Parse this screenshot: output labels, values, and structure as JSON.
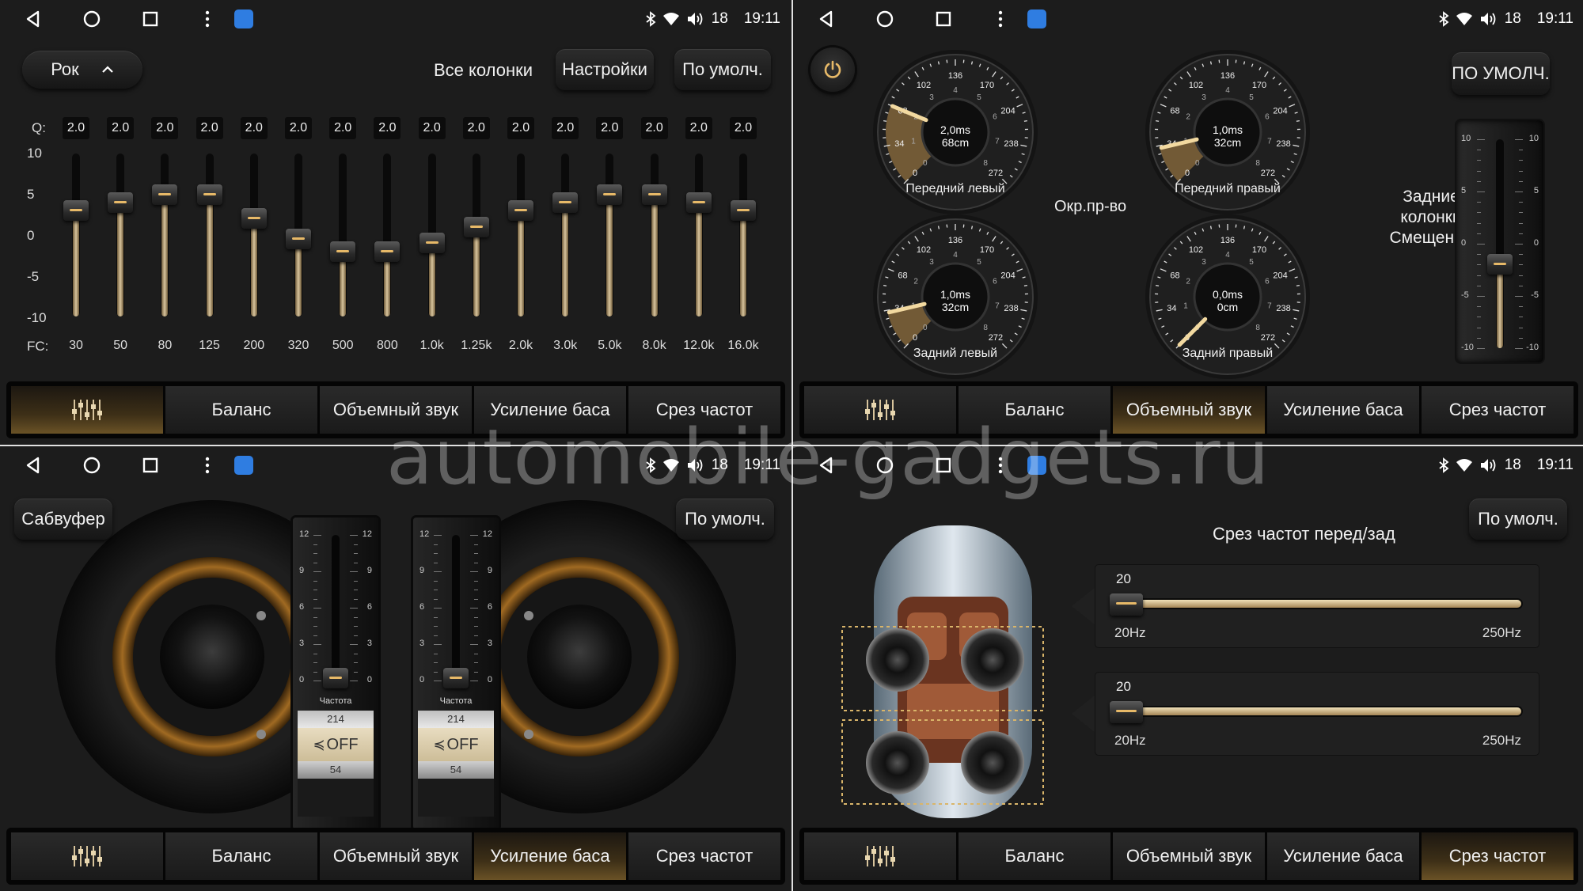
{
  "status": {
    "signal_value": "18",
    "time": "19:11"
  },
  "tabs": {
    "eq_icon": "equalizer-icon",
    "balance": "Баланс",
    "surround": "Объемный звук",
    "bass": "Усиление баса",
    "crossover": "Срез частот"
  },
  "eq": {
    "preset": "Рок",
    "all_speakers": "Все колонки",
    "settings_button": "Настройки",
    "default_button": "По умолч.",
    "q_label": "Q:",
    "fc_label": "FC:",
    "y_ticks": [
      "10",
      "5",
      "0",
      "-5",
      "-10"
    ],
    "bands": [
      {
        "q": "2.0",
        "fc": "30",
        "gain": 3
      },
      {
        "q": "2.0",
        "fc": "50",
        "gain": 4
      },
      {
        "q": "2.0",
        "fc": "80",
        "gain": 5
      },
      {
        "q": "2.0",
        "fc": "125",
        "gain": 5
      },
      {
        "q": "2.0",
        "fc": "200",
        "gain": 2
      },
      {
        "q": "2.0",
        "fc": "320",
        "gain": -0.5
      },
      {
        "q": "2.0",
        "fc": "500",
        "gain": -2
      },
      {
        "q": "2.0",
        "fc": "800",
        "gain": -2
      },
      {
        "q": "2.0",
        "fc": "1.0k",
        "gain": -1
      },
      {
        "q": "2.0",
        "fc": "1.25k",
        "gain": 1
      },
      {
        "q": "2.0",
        "fc": "2.0k",
        "gain": 3
      },
      {
        "q": "2.0",
        "fc": "3.0k",
        "gain": 4
      },
      {
        "q": "2.0",
        "fc": "5.0k",
        "gain": 5
      },
      {
        "q": "2.0",
        "fc": "8.0k",
        "gain": 5
      },
      {
        "q": "2.0",
        "fc": "12.0k",
        "gain": 4
      },
      {
        "q": "2.0",
        "fc": "16.0k",
        "gain": 3
      }
    ]
  },
  "surround": {
    "default_button": "ПО УМОЛЧ.",
    "center_label": "Окр.пр-во",
    "rear_label_1": "Задние",
    "rear_label_2": "колонки",
    "rear_label_3": "Смещение",
    "dial_ticks": [
      "0",
      "34",
      "68",
      "102",
      "136",
      "170",
      "204",
      "238",
      "272"
    ],
    "inner_ticks": [
      "0",
      "1",
      "2",
      "3",
      "4",
      "5",
      "6",
      "7",
      "8"
    ],
    "gauges": [
      {
        "label": "Передний левый",
        "ms": "2,0ms",
        "cm": "68cm",
        "value": 68
      },
      {
        "label": "Передний правый",
        "ms": "1,0ms",
        "cm": "32cm",
        "value": 32
      },
      {
        "label": "Задний левый",
        "ms": "1,0ms",
        "cm": "32cm",
        "value": 32
      },
      {
        "label": "Задний правый",
        "ms": "0,0ms",
        "cm": "0cm",
        "value": 0
      }
    ],
    "rear_slider": {
      "ticks": [
        "10",
        "5",
        "0",
        "-5",
        "-10"
      ],
      "value": -2
    }
  },
  "bass": {
    "subwoofer_button": "Сабвуфер",
    "default_button": "По умолч.",
    "slider_ticks": [
      "12",
      "9",
      "6",
      "3",
      "0"
    ],
    "freq_label": "Частота",
    "sliders": [
      {
        "value": 0,
        "freq_top": "214",
        "freq_sel": "OFF",
        "freq_bottom": "54"
      },
      {
        "value": 0,
        "freq_top": "214",
        "freq_sel": "OFF",
        "freq_bottom": "54"
      }
    ]
  },
  "crossover": {
    "default_button": "По умолч.",
    "title": "Срез частот перед/зад",
    "sliders": [
      {
        "value": "20",
        "min": "20Hz",
        "max": "250Hz"
      },
      {
        "value": "20",
        "min": "20Hz",
        "max": "250Hz"
      }
    ]
  },
  "watermark": "automobile-gadgets.ru",
  "colors": {
    "accent": "#e7b968",
    "active_tab": "#6a5226",
    "background": "#1c1c1c"
  }
}
